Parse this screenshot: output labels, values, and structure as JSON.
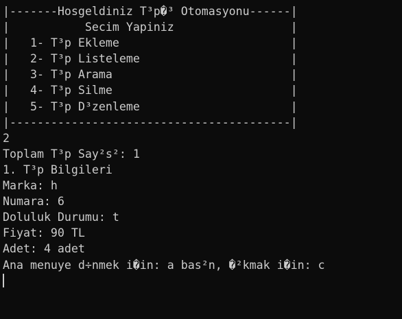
{
  "menu": {
    "header": "|-------Hosgeldiniz T³p�³ Otomasyonu------|",
    "title_row": "|           Secim Yapiniz                 |",
    "items": [
      "|   1- T³p Ekleme                         |",
      "|   2- T³p Listeleme                      |",
      "|   3- T³p Arama                          |",
      "|   4- T³p Silme                          |",
      "|   5- T³p D³zenleme                      |"
    ],
    "footer": "|-----------------------------------------|"
  },
  "output": {
    "user_choice": "2",
    "total_count": "Toplam T³p Say²s²: 1",
    "info_header": "1. T³p Bilgileri",
    "brand": "Marka: h",
    "number": "Numara: 6",
    "fill_status": "Doluluk Durumu: t",
    "price": "Fiyat: 90 TL",
    "quantity": "Adet: 4 adet",
    "prompt": "Ana menuye d÷nmek i�in: a bas²n, �²kmak i�in: c"
  }
}
